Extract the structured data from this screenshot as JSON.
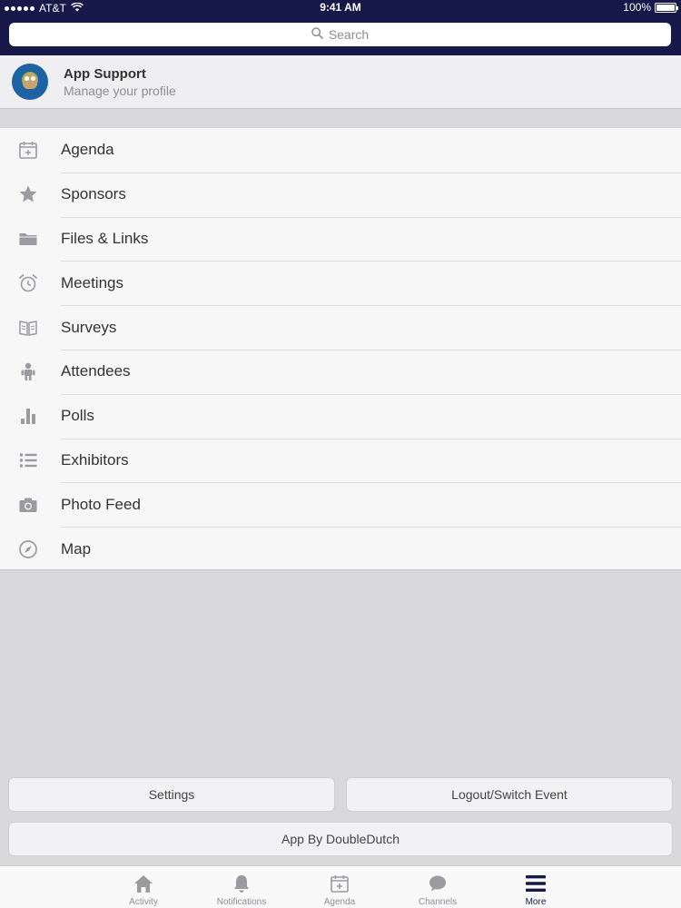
{
  "status_bar": {
    "carrier": "AT&T",
    "time": "9:41 AM",
    "battery": "100%"
  },
  "search": {
    "placeholder": "Search"
  },
  "profile": {
    "name": "App Support",
    "subtitle": "Manage your profile"
  },
  "menu": {
    "items": [
      {
        "label": "Agenda",
        "icon": "calendar-add-icon"
      },
      {
        "label": "Sponsors",
        "icon": "star-icon"
      },
      {
        "label": "Files & Links",
        "icon": "folder-icon"
      },
      {
        "label": "Meetings",
        "icon": "alarm-clock-icon"
      },
      {
        "label": "Surveys",
        "icon": "book-icon"
      },
      {
        "label": "Attendees",
        "icon": "person-icon"
      },
      {
        "label": "Polls",
        "icon": "bar-chart-icon"
      },
      {
        "label": "Exhibitors",
        "icon": "list-icon"
      },
      {
        "label": "Photo Feed",
        "icon": "camera-icon"
      },
      {
        "label": "Map",
        "icon": "compass-icon"
      }
    ]
  },
  "buttons": {
    "settings": "Settings",
    "logout": "Logout/Switch Event",
    "app_by": "App By DoubleDutch"
  },
  "tabbar": {
    "tabs": [
      {
        "label": "Activity",
        "icon": "home-icon"
      },
      {
        "label": "Notifications",
        "icon": "bell-icon"
      },
      {
        "label": "Agenda",
        "icon": "calendar-add-icon"
      },
      {
        "label": "Channels",
        "icon": "chat-bubble-icon"
      },
      {
        "label": "More",
        "icon": "menu-icon",
        "active": true
      }
    ]
  },
  "colors": {
    "header_bg": "#16184a",
    "icon_gray": "#9a9aa0",
    "active_tab": "#16184a"
  }
}
